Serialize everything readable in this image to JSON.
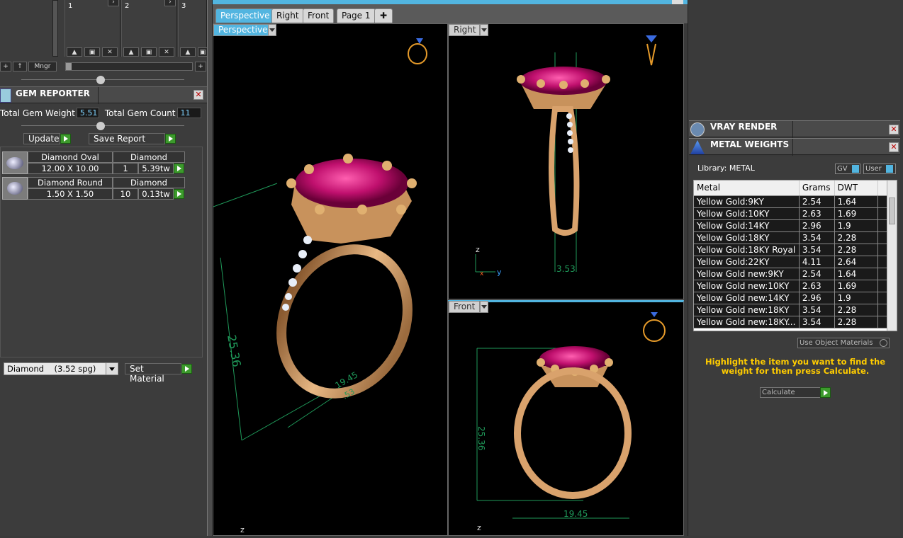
{
  "layers": {
    "box_labels": [
      "1",
      "2",
      "3"
    ],
    "toolbar": [
      "+",
      "↑",
      "Mngr"
    ],
    "plus": "+"
  },
  "gem_reporter": {
    "title": "GEM REPORTER",
    "total_weight_label": "Total Gem Weight",
    "total_weight": "5.51",
    "total_count_label": "Total Gem Count",
    "total_count": "11",
    "update": "Update",
    "save_report": "Save Report",
    "gems": [
      {
        "name": "Diamond Oval",
        "type": "Diamond",
        "size": "12.00 X 10.00",
        "count": "1",
        "weight": "5.39tw"
      },
      {
        "name": "Diamond Round",
        "type": "Diamond",
        "size": "1.50 X 1.50",
        "count": "10",
        "weight": "0.13tw"
      }
    ],
    "material_select": "Diamond    (3.52 spg)",
    "set_material": "Set Material"
  },
  "tabs": [
    {
      "label": "Perspective",
      "active": true
    },
    {
      "label": "Right"
    },
    {
      "label": "Front"
    },
    {
      "label": "Page 1"
    }
  ],
  "viewports": {
    "perspective": "Perspective",
    "right": "Right",
    "front": "Front",
    "dim_right": "3.53",
    "dim_persp": "25.36",
    "dim_persp2": "19.45",
    "dim_persp3": ".53",
    "dim_front_v": "25.36",
    "dim_front_h": "19.45",
    "axis_z": "z",
    "axis_y": "y",
    "axis_x": "x"
  },
  "vray": {
    "title": "VRAY RENDER"
  },
  "metal_weights": {
    "title": "METAL WEIGHTS",
    "library": "Library: METAL",
    "gv": "GV",
    "user": "User",
    "columns": [
      "Metal",
      "Grams",
      "DWT"
    ],
    "rows": [
      [
        "Yellow Gold:9KY",
        "2.54",
        "1.64"
      ],
      [
        "Yellow Gold:10KY",
        "2.63",
        "1.69"
      ],
      [
        "Yellow Gold:14KY",
        "2.96",
        "1.9"
      ],
      [
        "Yellow Gold:18KY",
        "3.54",
        "2.28"
      ],
      [
        "Yellow Gold:18KY Royal",
        "3.54",
        "2.28"
      ],
      [
        "Yellow Gold:22KY",
        "4.11",
        "2.64"
      ],
      [
        "Yellow Gold new:9KY",
        "2.54",
        "1.64"
      ],
      [
        "Yellow Gold new:10KY",
        "2.63",
        "1.69"
      ],
      [
        "Yellow Gold new:14KY",
        "2.96",
        "1.9"
      ],
      [
        "Yellow Gold new:18KY",
        "3.54",
        "2.28"
      ],
      [
        "Yellow Gold new:18KY...",
        "3.54",
        "2.28"
      ]
    ],
    "use_object_materials": "Use Object Materials",
    "hint": "Highlight the item you want to find the weight for then press Calculate.",
    "calculate": "Calculate"
  },
  "colors": {
    "accent": "#52b5e0",
    "green": "#3c9a2c",
    "hint": "#ffcc00",
    "gem": "#c0106e",
    "gold": "#d9a26c"
  }
}
